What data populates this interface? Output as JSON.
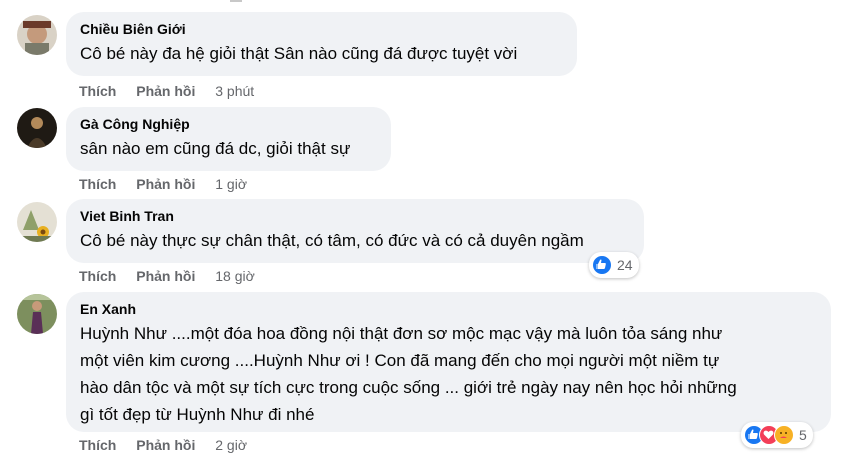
{
  "comments": [
    {
      "author": "Chiều Biên Giới",
      "text": "Cô bé này đa hệ giỏi thật Sân nào cũng đá được tuyệt vời",
      "like": "Thích",
      "reply": "Phản hồi",
      "time": "3 phút"
    },
    {
      "author": "Gà Công Nghiệp",
      "text": "sân nào em cũng đá dc, giỏi thật sự",
      "like": "Thích",
      "reply": "Phản hồi",
      "time": "1 giờ"
    },
    {
      "author": "Viet Binh Tran",
      "text": "Cô bé này thực sự chân thật, có tâm, có đức và có cả duyên ngầm",
      "like": "Thích",
      "reply": "Phản hồi",
      "time": "18 giờ",
      "reactions": {
        "icons": [
          "like-icon"
        ],
        "count": "24"
      }
    },
    {
      "author": "En Xanh",
      "text_lines": [
        "Huỳnh Như ....một đóa hoa đồng nội thật đơn sơ mộc mạc vậy mà luôn tỏa sáng như",
        "một viên kim cương ....Huỳnh Như ơi ! Con đã mang đến cho mọi người một niềm tự",
        "hào dân tộc và một sự tích cực trong cuộc sống ... giới trẻ ngày nay nên học hỏi những",
        "gì tốt đẹp từ Huỳnh Như đi nhé"
      ],
      "like": "Thích",
      "reply": "Phản hồi",
      "time": "2 giờ",
      "reactions": {
        "icons": [
          "like-icon",
          "love-icon",
          "care-icon"
        ],
        "count": "5"
      }
    }
  ],
  "colors": {
    "bubble": "#f0f2f5",
    "secondary_text": "#65676b",
    "like_blue": "#1877f2",
    "love_red": "#f33e58",
    "care_yellow": "#f7b125"
  }
}
